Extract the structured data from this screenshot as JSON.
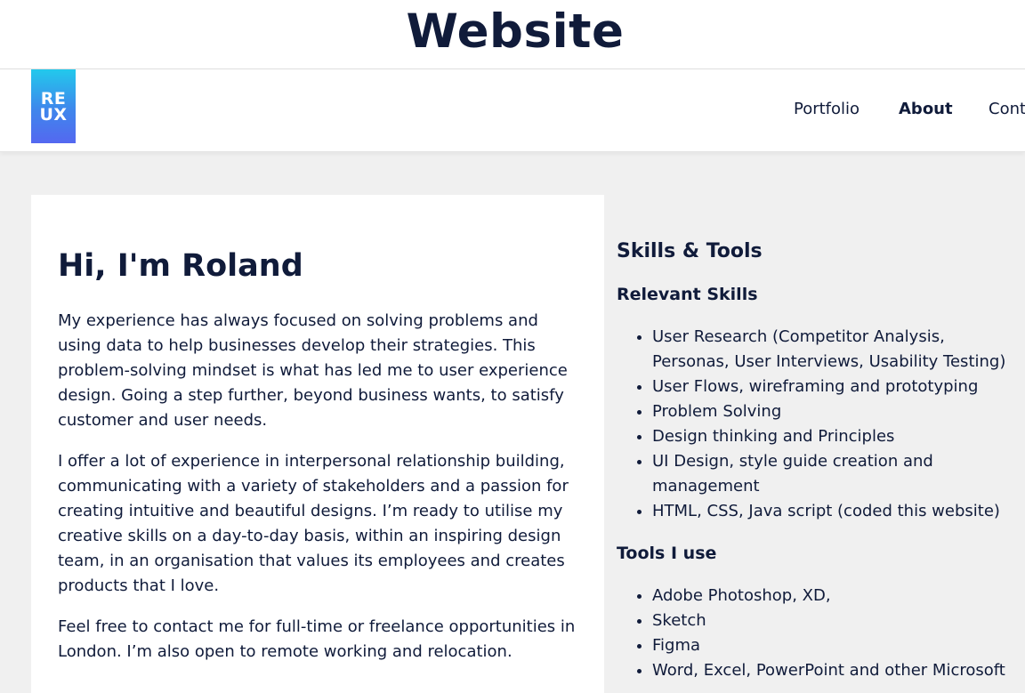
{
  "site_title": "Website",
  "logo": {
    "line1": "RE",
    "line2": "UX"
  },
  "nav": {
    "portfolio": "Portfolio",
    "about": "About",
    "contact": "Cont"
  },
  "intro": {
    "heading": "Hi, I'm Roland",
    "paragraph1": "My experience has always focused on solving problems and using data to help businesses develop their strategies. This problem-solving mindset is what has led me to user experience design. Going a step further, beyond business wants, to satisfy customer and user needs.",
    "paragraph2": "I offer a lot of experience in interpersonal relationship building, communicating with a variety of stakeholders and a passion for creating intuitive and beautiful designs. I’m ready to utilise my creative skills on a day-to-day basis, within an inspiring design team, in an organisation that values its employees and creates products that I love.",
    "paragraph3": "Feel free to contact me for full-time or freelance opportunities in London. I’m also open to remote working and relocation."
  },
  "skills": {
    "heading": "Skills & Tools",
    "relevant_heading": "Relevant Skills",
    "relevant": [
      "User Research (Competitor Analysis, Personas, User Interviews, Usability Testing)",
      "User Flows, wireframing and prototyping",
      "Problem Solving",
      "Design thinking and Principles",
      "UI Design, style guide creation and management",
      "HTML, CSS, Java script (coded this website)"
    ],
    "tools_heading": "Tools I use",
    "tools": [
      "Adobe Photoshop, XD,",
      "Sketch",
      "Figma",
      "Word, Excel, PowerPoint and other Microsoft"
    ]
  }
}
